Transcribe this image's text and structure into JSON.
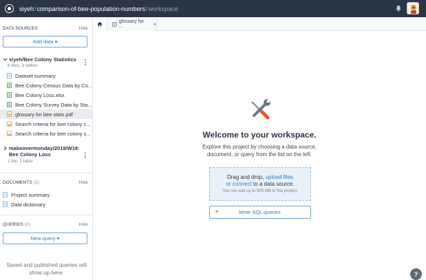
{
  "topbar": {
    "owner": "siyeh",
    "project": "comparison-of-bee-population-numbers",
    "separator": "/",
    "section": "workspace"
  },
  "sidebar": {
    "data_sources": {
      "title": "DATA SOURCES",
      "hide": "Hide",
      "add_button": "Add data ▾",
      "datasets": [
        {
          "title": "siyeh/Bee Colony Statistics",
          "meta": "6 files, 3 tables",
          "files": [
            {
              "name": "Dataset summary",
              "icon": "doc-icon"
            },
            {
              "name": "Bee Colony Census Data by Co...",
              "icon": "table-icon"
            },
            {
              "name": "Bee Colony Loss.xlsx",
              "icon": "table-icon"
            },
            {
              "name": "Bee Colony Survey Data by Sta...",
              "icon": "table-icon"
            },
            {
              "name": "glossary for bee stats.pdf",
              "icon": "pdf-icon"
            },
            {
              "name": "Search criteria for bee colony c...",
              "icon": "image-icon"
            },
            {
              "name": "Search criteria for bee colony s...",
              "icon": "image-icon"
            }
          ]
        },
        {
          "title_line1": "makeovermonday/2018/W18:",
          "title_line2": "Bee Colony Loss",
          "meta": "1 file, 1 table"
        }
      ]
    },
    "documents": {
      "title": "DOCUMENTS",
      "count": "(2)",
      "hide": "Hide",
      "items": [
        "Project summary",
        "Data dictionary"
      ]
    },
    "queries": {
      "title": "QUERIES",
      "count": "(0)",
      "hide": "Hide",
      "new_button": "New query ▾",
      "empty_line1": "Saved and published queries will",
      "empty_line2": "show up here."
    }
  },
  "tabs": {
    "doc_tab": "glossary for ...",
    "close": "×"
  },
  "main": {
    "welcome": "Welcome to your workspace.",
    "sub_line1": "Explore this project by choosing a data source,",
    "sub_line2": "document, or query from the list on the left.",
    "drop": {
      "text1": "Drag and drop, ",
      "link1": "upload files",
      "link2": "or connect",
      "text2": " to a data source.",
      "limit": "You can add up to 500 MB to this project."
    },
    "sql_button": "Write SQL queries",
    "help": "?"
  },
  "colors": {
    "topbar": "#2b3546",
    "link": "#2f7bc5",
    "dropzone_bg": "#e8f0f8"
  }
}
